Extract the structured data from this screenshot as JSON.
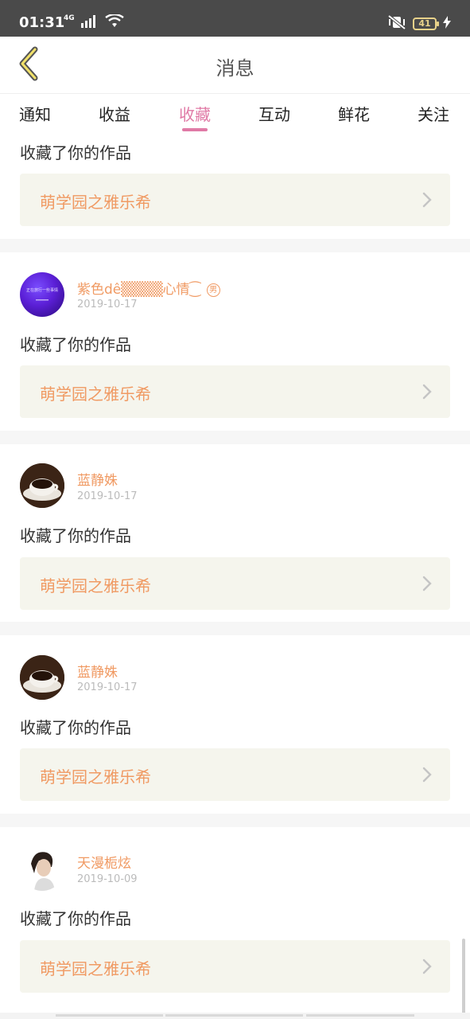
{
  "status_bar": {
    "time": "01:31",
    "network": "4G",
    "battery": "41",
    "icons": [
      "signal-icon",
      "wifi-icon",
      "vibrate-icon",
      "battery-icon",
      "charging-icon"
    ]
  },
  "header": {
    "title": "消息",
    "back_icon": "chevron-left-icon"
  },
  "tabs": [
    {
      "label": "通知"
    },
    {
      "label": "收益"
    },
    {
      "label": "收藏",
      "active": true
    },
    {
      "label": "互动"
    },
    {
      "label": "鲜花"
    },
    {
      "label": "关注"
    }
  ],
  "colors": {
    "accent": "#e07aa6",
    "name": "#f09a63",
    "card_bg": "#f5f5ed"
  },
  "feed": {
    "partial_top": {
      "action": "收藏了你的作品",
      "work_title": "萌学园之雅乐希"
    },
    "items": [
      {
        "name": "紫色dê▒▒▒▒心情⁐",
        "gender": "男",
        "date": "2019-10-17",
        "action": "收藏了你的作品",
        "work_title": "萌学园之雅乐希",
        "avatar_text": "正在旅行一些事情"
      },
      {
        "name": "蓝静姝",
        "date": "2019-10-17",
        "action": "收藏了你的作品",
        "work_title": "萌学园之雅乐希"
      },
      {
        "name": "蓝静姝",
        "date": "2019-10-17",
        "action": "收藏了你的作品",
        "work_title": "萌学园之雅乐希"
      },
      {
        "name": "天漫栀炫",
        "date": "2019-10-09",
        "action": "收藏了你的作品",
        "work_title": "萌学园之雅乐希"
      }
    ]
  }
}
